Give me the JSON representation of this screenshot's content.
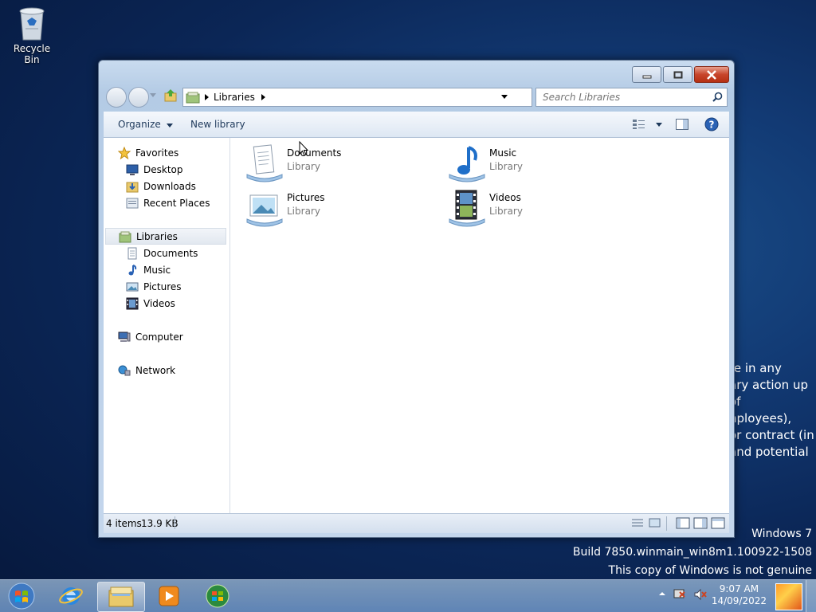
{
  "desktop": {
    "recycle_bin_label": "Recycle Bin",
    "bg_text_lines": [
      "re in any",
      "ary action up",
      "of",
      "nployees),",
      " or contract (in",
      "and potential"
    ],
    "watermark": {
      "line1": "Windows 7",
      "line2": "Build 7850.winmain_win8m1.100922-1508",
      "line3": "This copy of Windows is not genuine"
    }
  },
  "window": {
    "address": {
      "crumb": "Libraries"
    },
    "search": {
      "placeholder": "Search Libraries"
    },
    "toolbar": {
      "organize_label": "Organize",
      "new_library_label": "New library"
    },
    "nav": {
      "favorites": "Favorites",
      "desktop": "Desktop",
      "downloads": "Downloads",
      "recent_places": "Recent Places",
      "libraries": "Libraries",
      "documents": "Documents",
      "music": "Music",
      "pictures": "Pictures",
      "videos": "Videos",
      "computer": "Computer",
      "network": "Network"
    },
    "libraries": [
      {
        "name": "Documents",
        "type": "Library"
      },
      {
        "name": "Music",
        "type": "Library"
      },
      {
        "name": "Pictures",
        "type": "Library"
      },
      {
        "name": "Videos",
        "type": "Library"
      }
    ],
    "status": {
      "count": "4 items",
      "size": "13.9 KB"
    }
  },
  "taskbar": {
    "clock_time": "9:07 AM",
    "clock_date": "14/09/2022"
  },
  "colors": {
    "accent": "#1e395b",
    "close_red": "#c7452b",
    "desktop_blue": "#123a74"
  }
}
